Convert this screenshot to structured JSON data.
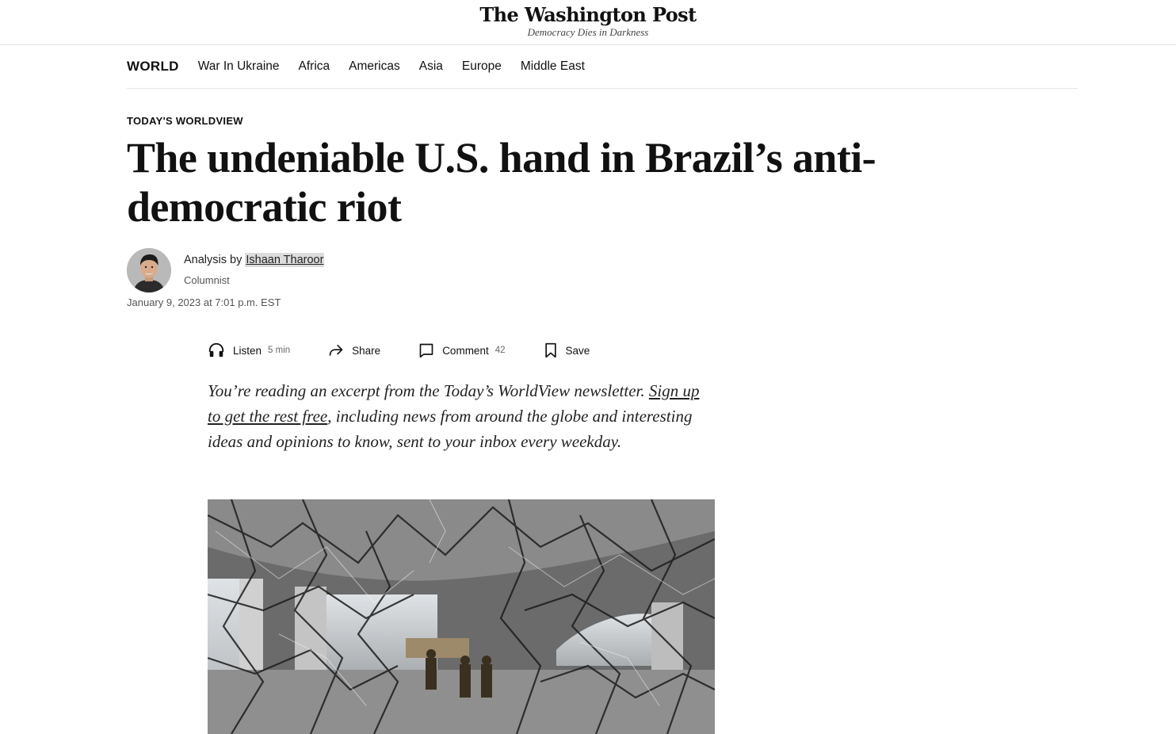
{
  "masthead": {
    "logo": "The Washington Post",
    "tagline": "Democracy Dies in Darkness"
  },
  "section_nav": {
    "title": "WORLD",
    "items": [
      "War In Ukraine",
      "Africa",
      "Americas",
      "Asia",
      "Europe",
      "Middle East"
    ]
  },
  "article": {
    "kicker": "TODAY'S WORLDVIEW",
    "headline": "The undeniable U.S. hand in Brazil’s anti-democratic riot",
    "byline_prefix": "Analysis by",
    "author": "Ishaan Tharoor",
    "author_role": "Columnist",
    "published": "January 9, 2023 at 7:01 p.m. EST"
  },
  "toolbar": {
    "listen_label": "Listen",
    "listen_duration": "5 min",
    "share_label": "Share",
    "comment_label": "Comment",
    "comment_count": "42",
    "save_label": "Save"
  },
  "intro": {
    "lead": "You’re reading an excerpt from the Today’s WorldView newsletter. ",
    "link_text": "Sign up to get the rest free",
    "rest": ", including news from around the globe and interesting ideas and opinions to know, sent to your inbox every weekday."
  },
  "icons": {
    "listen": "headphones-icon",
    "share": "share-arrow-icon",
    "comment": "comment-bubble-icon",
    "save": "bookmark-icon"
  }
}
